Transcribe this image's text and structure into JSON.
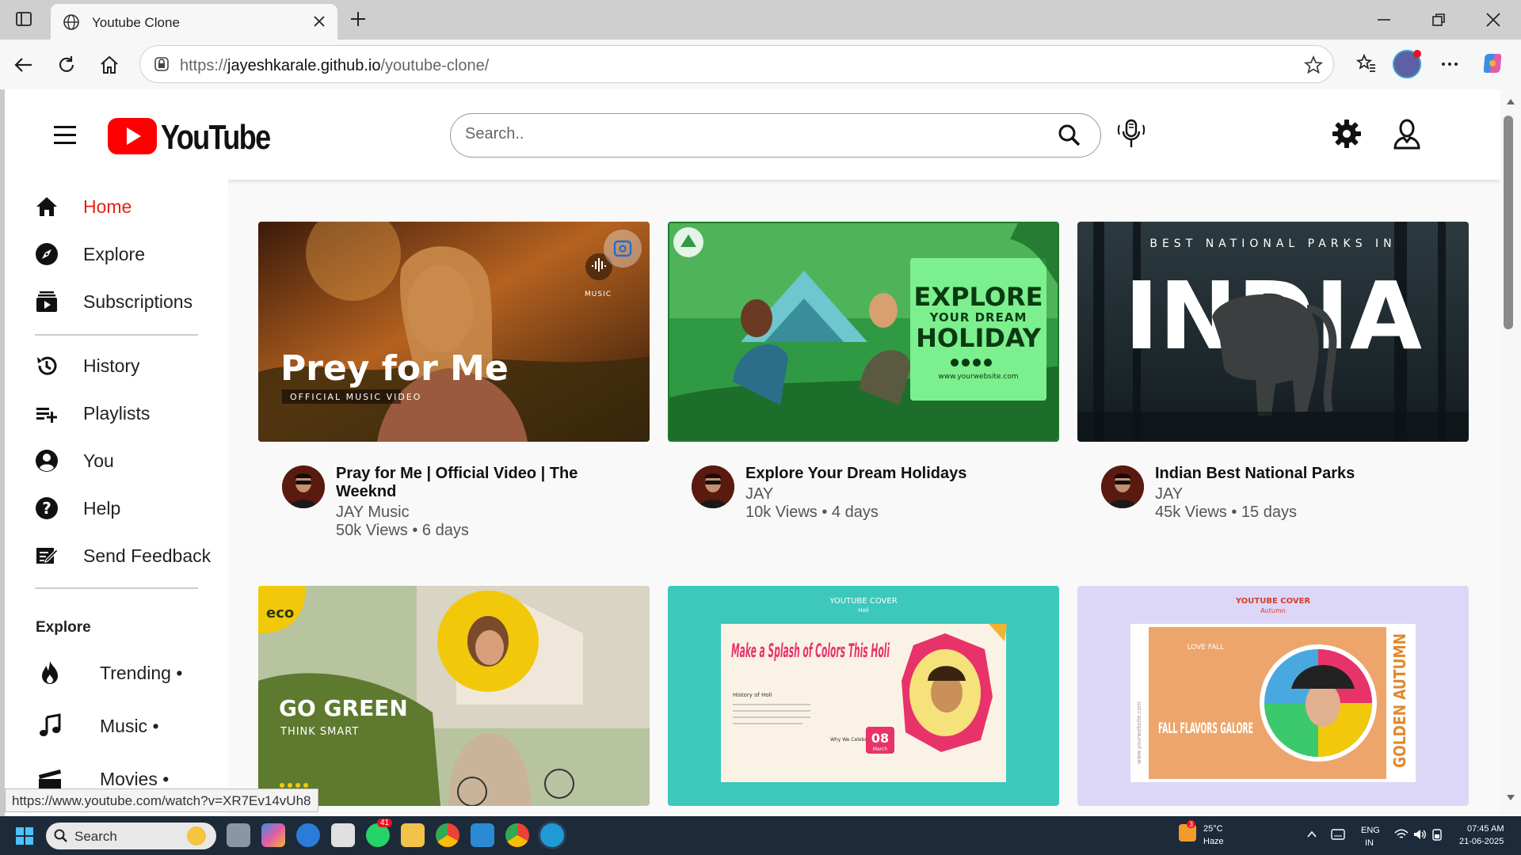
{
  "browser": {
    "tab_title": "Youtube Clone",
    "url_prefix": "https://",
    "url_domain": "jayeshkarale.github.io",
    "url_path": "/youtube-clone/",
    "status_url": "https://www.youtube.com/watch?v=XR7Ev14vUh8"
  },
  "header": {
    "logo_text": "YouTube",
    "search_placeholder": "Search.."
  },
  "sidebar": {
    "main": [
      {
        "label": "Home",
        "icon": "home-icon"
      },
      {
        "label": "Explore",
        "icon": "compass-icon"
      },
      {
        "label": "Subscriptions",
        "icon": "subscriptions-icon"
      }
    ],
    "library": [
      {
        "label": "History",
        "icon": "history-icon"
      },
      {
        "label": "Playlists",
        "icon": "playlist-add-icon"
      },
      {
        "label": "You",
        "icon": "account-icon"
      },
      {
        "label": "Help",
        "icon": "help-icon"
      },
      {
        "label": "Send Feedback",
        "icon": "feedback-icon"
      }
    ],
    "explore_heading": "Explore",
    "explore": [
      {
        "label": "Trending •",
        "icon": "fire-icon"
      },
      {
        "label": "Music •",
        "icon": "music-note-icon"
      },
      {
        "label": "Movies •",
        "icon": "clapperboard-icon"
      }
    ]
  },
  "videos": [
    {
      "title": "Pray for Me | Official Video | The Weeknd",
      "channel": "JAY Music",
      "meta": "50k Views • 6 days",
      "thumb_text": "Prey for Me",
      "thumb_sub": "OFFICIAL MUSIC VIDEO",
      "thumb_badge": "MUSIC"
    },
    {
      "title": "Explore Your Dream Holidays",
      "channel": "JAY",
      "meta": "10k Views • 4 days",
      "thumb_text": "EXPLORE",
      "thumb_sub": "YOUR DREAM",
      "thumb_sub2": "HOLIDAY",
      "thumb_url": "www.yourwebsite.com"
    },
    {
      "title": "Indian Best National Parks",
      "channel": "JAY",
      "meta": "45k Views • 15 days",
      "thumb_text": "INDIA",
      "thumb_sub": "BEST NATIONAL PARKS IN"
    },
    {
      "thumb_text": "GO GREEN",
      "thumb_sub": "THINK SMART",
      "thumb_badge": "eco"
    },
    {
      "thumb_text": "Make a Splash of Colors This Holi",
      "thumb_sub": "YOUTUBE COVER",
      "thumb_badge": "Holi",
      "thumb_date": "08",
      "thumb_month": "March",
      "thumb_history": "History of Holi",
      "thumb_why": "Why We Celebrate Holi?"
    },
    {
      "thumb_text": "FALL FLAVORS GALORE",
      "thumb_sub": "YOUTUBE COVER",
      "thumb_badge": "Autumn",
      "thumb_side": "GOLDEN AUTUMN",
      "thumb_love": "LOVE FALL",
      "thumb_url": "www.yourwebsite.com"
    }
  ],
  "taskbar": {
    "search_label": "Search",
    "weather_temp": "25°C",
    "weather_desc": "Haze",
    "weather_badge": "3",
    "whatsapp_badge": "41",
    "lang": "ENG",
    "region": "IN",
    "time": "07:45 AM",
    "date": "21-06-2025"
  },
  "colors": {
    "youtube_red": "#ff0000",
    "active_nav": "#e62117",
    "taskbar": "#1c2a3a"
  }
}
